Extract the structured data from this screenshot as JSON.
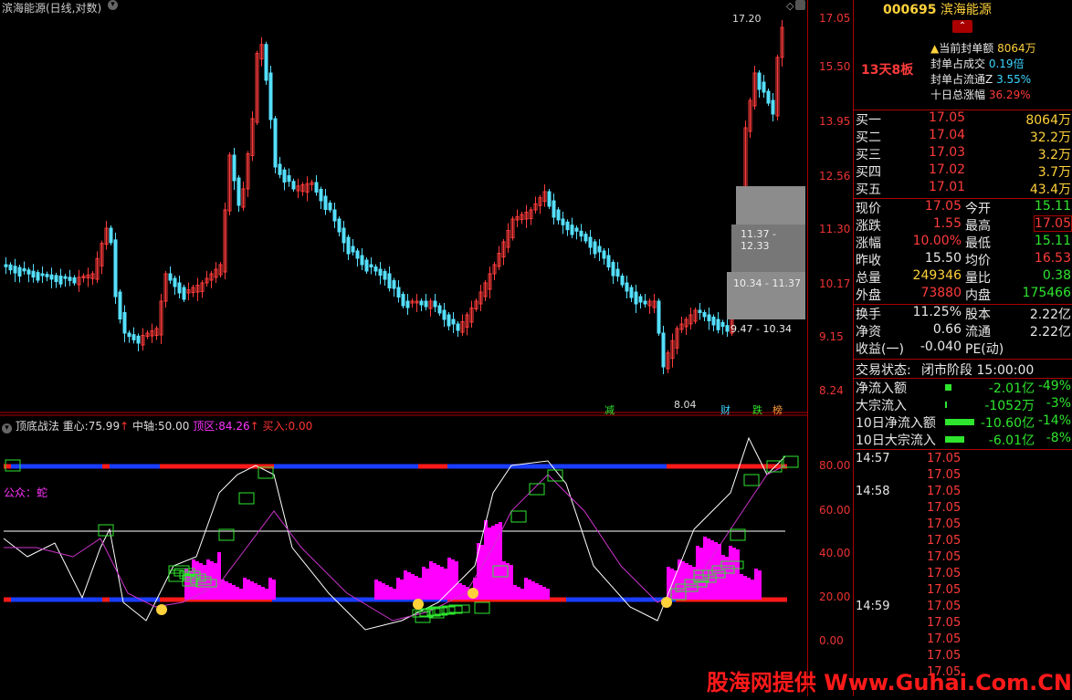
{
  "chart_header": {
    "title": "滨海能源(日线,对数)"
  },
  "price_axis": {
    "upper": [
      "17.05",
      "15.50",
      "13.95",
      "12.56",
      "11.30",
      "10.17",
      "9.15",
      "8.24"
    ],
    "lower": [
      "80.00",
      "60.00",
      "40.00",
      "20.00",
      "0.00"
    ]
  },
  "annotations": {
    "high_label": "17.20",
    "low_label": "8.04",
    "range_1": "11.37 - 12.33",
    "range_2": "10.34 - 11.37",
    "range_3": "9.47 - 10.34",
    "markers": [
      "减",
      "财",
      "跌",
      "榜"
    ],
    "gongzhong": "公众：蛇"
  },
  "indicator_header": {
    "name": "顶底战法",
    "zhongxin_label": "重心:",
    "zhongxin_value": "75.99",
    "zhongzhou_label": "中轴:",
    "zhongzhou_value": "50.00",
    "dingqu_label": "顶区:",
    "dingqu_value": "84.26",
    "mairu_label": "买入:",
    "mairu_value": "0.00"
  },
  "stock": {
    "code": "000695",
    "name": "滨海能源",
    "days_label": "13天8板",
    "seal_amount_label": "当前封单额",
    "seal_amount_value": "8064万",
    "seal_vol_label": "封单占成交",
    "seal_vol_value": "0.19倍",
    "seal_float_label": "封单占流通Z",
    "seal_float_value": "3.55%",
    "ten_day_label": "十日总涨幅",
    "ten_day_value": "36.29%"
  },
  "order_book": [
    {
      "label": "买一",
      "price": "17.05",
      "vol": "8064万"
    },
    {
      "label": "买二",
      "price": "17.04",
      "vol": "32.2万"
    },
    {
      "label": "买三",
      "price": "17.03",
      "vol": "3.2万"
    },
    {
      "label": "买四",
      "price": "17.02",
      "vol": "3.7万"
    },
    {
      "label": "买五",
      "price": "17.01",
      "vol": "43.4万"
    }
  ],
  "quote": [
    {
      "l1": "现价",
      "v1": "17.05",
      "c1": "red",
      "l2": "今开",
      "v2": "15.11",
      "c2": "green"
    },
    {
      "l1": "涨跌",
      "v1": "1.55",
      "c1": "red",
      "l2": "最高",
      "v2": "17.05",
      "c2": "red"
    },
    {
      "l1": "涨幅",
      "v1": "10.00%",
      "c1": "red",
      "l2": "最低",
      "v2": "15.11",
      "c2": "green"
    },
    {
      "l1": "昨收",
      "v1": "15.50",
      "c1": "white",
      "l2": "均价",
      "v2": "16.53",
      "c2": "red"
    },
    {
      "l1": "总量",
      "v1": "249346",
      "c1": "yellow",
      "l2": "量比",
      "v2": "0.38",
      "c2": "green"
    },
    {
      "l1": "外盘",
      "v1": "73880",
      "c1": "red",
      "l2": "内盘",
      "v2": "175466",
      "c2": "green"
    }
  ],
  "fundamentals": [
    {
      "l1": "换手",
      "v1": "11.25%",
      "l2": "股本",
      "v2": "2.22亿"
    },
    {
      "l1": "净资",
      "v1": "0.66",
      "l2": "流通",
      "v2": "2.22亿"
    },
    {
      "l1": "收益(一)",
      "v1": "-0.040",
      "l2": "PE(动)",
      "v2": ""
    }
  ],
  "trade_status": {
    "label": "交易状态:",
    "value": "闭市阶段 15:00:00"
  },
  "flows": [
    {
      "label": "净流入额",
      "value": "-2.01亿",
      "pct": "-49%",
      "bar": 8
    },
    {
      "label": "大宗流入",
      "value": "-1052万",
      "pct": "-3%",
      "bar": 2
    },
    {
      "label": "10日净流入额",
      "value": "-10.60亿",
      "pct": "-14%",
      "bar": 36
    },
    {
      "label": "10日大宗流入",
      "value": "-6.01亿",
      "pct": "-8%",
      "bar": 24
    }
  ],
  "ticks": [
    {
      "time": "14:57",
      "price": "17.05"
    },
    {
      "time": "",
      "price": "17.05"
    },
    {
      "time": "14:58",
      "price": "17.05"
    },
    {
      "time": "",
      "price": "17.05"
    },
    {
      "time": "",
      "price": "17.05"
    },
    {
      "time": "",
      "price": "17.05"
    },
    {
      "time": "",
      "price": "17.05"
    },
    {
      "time": "",
      "price": "17.05"
    },
    {
      "time": "",
      "price": "17.05"
    },
    {
      "time": "14:59",
      "price": "17.05"
    },
    {
      "time": "",
      "price": "17.05"
    },
    {
      "time": "",
      "price": "17.05"
    },
    {
      "time": "",
      "price": "17.05"
    },
    {
      "time": "",
      "price": "17.05"
    }
  ],
  "watermark": "股海网提供 Www.Guhai.Com.CN",
  "colors": {
    "up": "#ff3b3b",
    "down": "#55e0ff",
    "magenta": "#ff00ff",
    "green": "#2ee62e",
    "blue": "#1a3dff",
    "border": "#aa0000"
  }
}
